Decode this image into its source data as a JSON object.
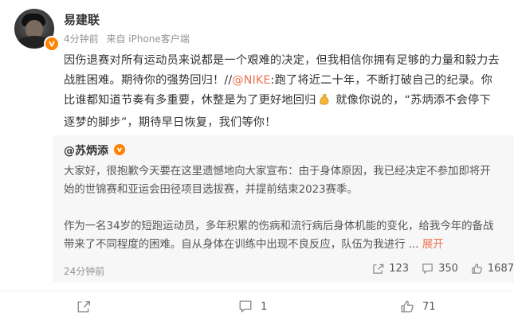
{
  "post": {
    "author": "易建联",
    "time": "4分钟前",
    "source": "来自 iPhone客户端",
    "text_before_mention": "因伤退赛对所有运动员来说都是一个艰难的决定，但我相信你拥有足够的力量和毅力去战胜困难。期待你的强势回归！//",
    "mention": "@NIKE",
    "text_after_mention": ":跑了将近二十年，不断打破自己的纪录。你比谁都知道节奏有多重要，休整是为了更好地回归",
    "text_after_emoji": " 就像你说的，“苏炳添不会停下逐梦的脚步”，期待早日恢复，我们等你！"
  },
  "retweet": {
    "author": "@苏炳添",
    "paragraph1": "大家好，很抱歉今天要在这里遗憾地向大家宣布：由于身体原因，我已经决定不参加即将开始的世锦赛和亚运会田径项目选拔赛，并提前结束2023赛季。",
    "paragraph2": "作为一名34岁的短跑运动员，多年积累的伤病和流行病后身体机能的变化，给我今年的备战带来了不同程度的困难。自从身体在训练中出现不良反应，队伍为我进行",
    "ellipsis": " ... ",
    "expand_label": "展开",
    "time": "24分钟前",
    "share_count": "123",
    "comment_count": "350",
    "like_count": "1687"
  },
  "footer": {
    "share_count": "",
    "comment_count": "1",
    "like_count": "71"
  },
  "colors": {
    "accent": "#eb7350",
    "verified": "#ff8200",
    "muted": "#939393",
    "retweet_bg": "#f7f7f7"
  },
  "icons": [
    "verified-badge-icon",
    "flexed-biceps-emoji-icon",
    "share-icon",
    "comment-icon",
    "like-icon"
  ]
}
